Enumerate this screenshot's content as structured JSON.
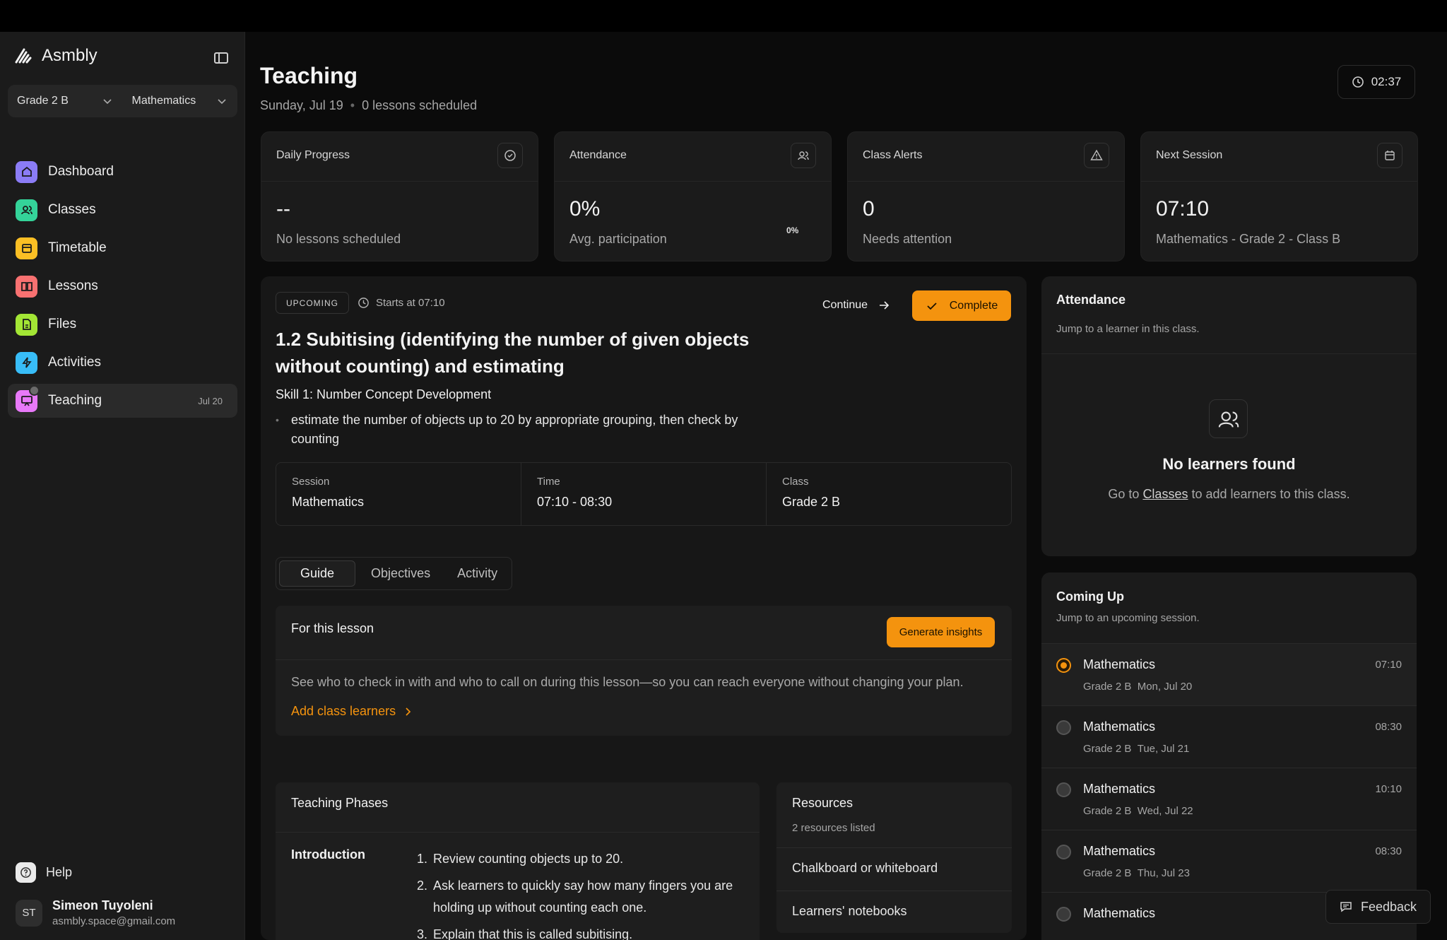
{
  "app": {
    "name": "Asmbly"
  },
  "sidebar": {
    "selectors": {
      "grade": "Grade 2 B",
      "subject": "Mathematics"
    },
    "items": [
      {
        "label": "Dashboard",
        "icon": "home-icon",
        "color": "#8b7cf6"
      },
      {
        "label": "Classes",
        "icon": "users-icon",
        "color": "#34d399"
      },
      {
        "label": "Timetable",
        "icon": "calendar-icon",
        "color": "#fbbf24"
      },
      {
        "label": "Lessons",
        "icon": "book-icon",
        "color": "#f87171"
      },
      {
        "label": "Files",
        "icon": "file-icon",
        "color": "#a3e635"
      },
      {
        "label": "Activities",
        "icon": "zap-icon",
        "color": "#38bdf8"
      },
      {
        "label": "Teaching",
        "icon": "presentation-icon",
        "color": "#e879f9",
        "date": "Jul 20"
      }
    ],
    "help_label": "Help",
    "user": {
      "initials": "ST",
      "name": "Simeon Tuyoleni",
      "email": "asmbly.space@gmail.com"
    }
  },
  "header": {
    "title": "Teaching",
    "date": "Sunday, Jul 19",
    "lessons_count": "0 lessons scheduled",
    "timer": "02:37"
  },
  "stats": [
    {
      "label": "Daily Progress",
      "icon": "check-circle-icon",
      "value": "--",
      "desc": "No lessons scheduled"
    },
    {
      "label": "Attendance",
      "icon": "users-icon",
      "value": "0%",
      "desc": "Avg. participation",
      "mini": "0%"
    },
    {
      "label": "Class Alerts",
      "icon": "alert-triangle-icon",
      "value": "0",
      "desc": "Needs attention"
    },
    {
      "label": "Next Session",
      "icon": "calendar-icon",
      "value": "07:10",
      "desc": "Mathematics - Grade 2 - Class B"
    }
  ],
  "lesson": {
    "status": "UPCOMING",
    "starts": "Starts at 07:10",
    "continue_label": "Continue",
    "complete_label": "Complete",
    "title": "1.2 Subitising (identifying the number of given objects without counting) and estimating",
    "skill": "Skill 1: Number Concept Development",
    "bullet": "estimate the number of objects up to 20 by appropriate grouping, then check by counting",
    "meta": [
      {
        "label": "Session",
        "value": "Mathematics"
      },
      {
        "label": "Time",
        "value": "07:10 - 08:30"
      },
      {
        "label": "Class",
        "value": "Grade 2 B"
      }
    ],
    "tabs": [
      "Guide",
      "Objectives",
      "Activity"
    ],
    "guide": {
      "title": "For this lesson",
      "button": "Generate insights",
      "text": "See who to check in with and who to call on during this lesson—so you can reach everyone without changing your plan.",
      "link": "Add class learners"
    },
    "phases": {
      "title": "Teaching Phases",
      "phase": "Introduction",
      "steps": [
        {
          "num": "1.",
          "text": "Review counting objects up to 20."
        },
        {
          "num": "2.",
          "text": "Ask learners to quickly say how many fingers you are holding up without counting each one."
        },
        {
          "num": "3.",
          "text": "Explain that this is called subitising."
        }
      ]
    },
    "resources": {
      "title": "Resources",
      "sub": "2 resources listed",
      "items": [
        "Chalkboard or whiteboard",
        "Learners' notebooks"
      ]
    }
  },
  "attendance": {
    "title": "Attendance",
    "sub": "Jump to a learner in this class.",
    "empty_title": "No learners found",
    "empty_pre": "Go to",
    "empty_link": "Classes",
    "empty_post": "to add learners to this class."
  },
  "coming_up": {
    "title": "Coming Up",
    "sub": "Jump to an upcoming session.",
    "items": [
      {
        "subject": "Mathematics",
        "grade": "Grade 2 B",
        "date": "Mon, Jul 20",
        "time": "07:10"
      },
      {
        "subject": "Mathematics",
        "grade": "Grade 2 B",
        "date": "Tue, Jul 21",
        "time": "08:30"
      },
      {
        "subject": "Mathematics",
        "grade": "Grade 2 B",
        "date": "Wed, Jul 22",
        "time": "10:10"
      },
      {
        "subject": "Mathematics",
        "grade": "Grade 2 B",
        "date": "Thu, Jul 23",
        "time": "08:30"
      },
      {
        "subject": "Mathematics",
        "grade": "",
        "date": "",
        "time": ""
      }
    ]
  },
  "feedback_label": "Feedback",
  "colors": {
    "accent": "#f4930e"
  }
}
